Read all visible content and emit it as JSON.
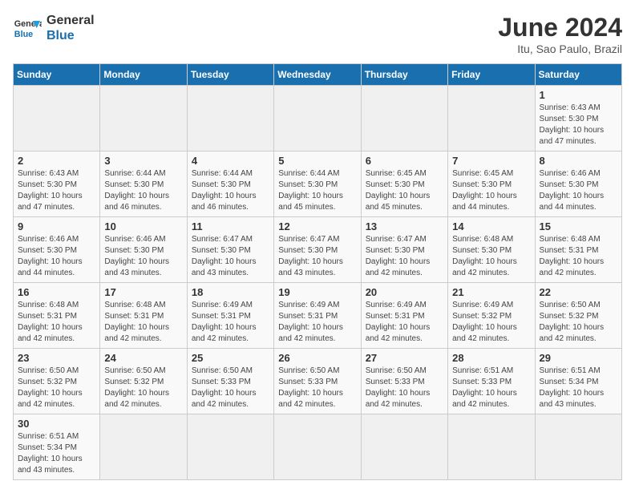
{
  "header": {
    "logo_line1": "General",
    "logo_line2": "Blue",
    "month_title": "June 2024",
    "subtitle": "Itu, Sao Paulo, Brazil"
  },
  "weekdays": [
    "Sunday",
    "Monday",
    "Tuesday",
    "Wednesday",
    "Thursday",
    "Friday",
    "Saturday"
  ],
  "weeks": [
    [
      {
        "day": "",
        "info": ""
      },
      {
        "day": "",
        "info": ""
      },
      {
        "day": "",
        "info": ""
      },
      {
        "day": "",
        "info": ""
      },
      {
        "day": "",
        "info": ""
      },
      {
        "day": "",
        "info": ""
      },
      {
        "day": "1",
        "info": "Sunrise: 6:43 AM\nSunset: 5:30 PM\nDaylight: 10 hours\nand 47 minutes."
      }
    ],
    [
      {
        "day": "2",
        "info": "Sunrise: 6:43 AM\nSunset: 5:30 PM\nDaylight: 10 hours\nand 47 minutes."
      },
      {
        "day": "3",
        "info": "Sunrise: 6:44 AM\nSunset: 5:30 PM\nDaylight: 10 hours\nand 46 minutes."
      },
      {
        "day": "4",
        "info": "Sunrise: 6:44 AM\nSunset: 5:30 PM\nDaylight: 10 hours\nand 46 minutes."
      },
      {
        "day": "5",
        "info": "Sunrise: 6:44 AM\nSunset: 5:30 PM\nDaylight: 10 hours\nand 45 minutes."
      },
      {
        "day": "6",
        "info": "Sunrise: 6:45 AM\nSunset: 5:30 PM\nDaylight: 10 hours\nand 45 minutes."
      },
      {
        "day": "7",
        "info": "Sunrise: 6:45 AM\nSunset: 5:30 PM\nDaylight: 10 hours\nand 44 minutes."
      },
      {
        "day": "8",
        "info": "Sunrise: 6:46 AM\nSunset: 5:30 PM\nDaylight: 10 hours\nand 44 minutes."
      }
    ],
    [
      {
        "day": "9",
        "info": "Sunrise: 6:46 AM\nSunset: 5:30 PM\nDaylight: 10 hours\nand 44 minutes."
      },
      {
        "day": "10",
        "info": "Sunrise: 6:46 AM\nSunset: 5:30 PM\nDaylight: 10 hours\nand 43 minutes."
      },
      {
        "day": "11",
        "info": "Sunrise: 6:47 AM\nSunset: 5:30 PM\nDaylight: 10 hours\nand 43 minutes."
      },
      {
        "day": "12",
        "info": "Sunrise: 6:47 AM\nSunset: 5:30 PM\nDaylight: 10 hours\nand 43 minutes."
      },
      {
        "day": "13",
        "info": "Sunrise: 6:47 AM\nSunset: 5:30 PM\nDaylight: 10 hours\nand 42 minutes."
      },
      {
        "day": "14",
        "info": "Sunrise: 6:48 AM\nSunset: 5:30 PM\nDaylight: 10 hours\nand 42 minutes."
      },
      {
        "day": "15",
        "info": "Sunrise: 6:48 AM\nSunset: 5:31 PM\nDaylight: 10 hours\nand 42 minutes."
      }
    ],
    [
      {
        "day": "16",
        "info": "Sunrise: 6:48 AM\nSunset: 5:31 PM\nDaylight: 10 hours\nand 42 minutes."
      },
      {
        "day": "17",
        "info": "Sunrise: 6:48 AM\nSunset: 5:31 PM\nDaylight: 10 hours\nand 42 minutes."
      },
      {
        "day": "18",
        "info": "Sunrise: 6:49 AM\nSunset: 5:31 PM\nDaylight: 10 hours\nand 42 minutes."
      },
      {
        "day": "19",
        "info": "Sunrise: 6:49 AM\nSunset: 5:31 PM\nDaylight: 10 hours\nand 42 minutes."
      },
      {
        "day": "20",
        "info": "Sunrise: 6:49 AM\nSunset: 5:31 PM\nDaylight: 10 hours\nand 42 minutes."
      },
      {
        "day": "21",
        "info": "Sunrise: 6:49 AM\nSunset: 5:32 PM\nDaylight: 10 hours\nand 42 minutes."
      },
      {
        "day": "22",
        "info": "Sunrise: 6:50 AM\nSunset: 5:32 PM\nDaylight: 10 hours\nand 42 minutes."
      }
    ],
    [
      {
        "day": "23",
        "info": "Sunrise: 6:50 AM\nSunset: 5:32 PM\nDaylight: 10 hours\nand 42 minutes."
      },
      {
        "day": "24",
        "info": "Sunrise: 6:50 AM\nSunset: 5:32 PM\nDaylight: 10 hours\nand 42 minutes."
      },
      {
        "day": "25",
        "info": "Sunrise: 6:50 AM\nSunset: 5:33 PM\nDaylight: 10 hours\nand 42 minutes."
      },
      {
        "day": "26",
        "info": "Sunrise: 6:50 AM\nSunset: 5:33 PM\nDaylight: 10 hours\nand 42 minutes."
      },
      {
        "day": "27",
        "info": "Sunrise: 6:50 AM\nSunset: 5:33 PM\nDaylight: 10 hours\nand 42 minutes."
      },
      {
        "day": "28",
        "info": "Sunrise: 6:51 AM\nSunset: 5:33 PM\nDaylight: 10 hours\nand 42 minutes."
      },
      {
        "day": "29",
        "info": "Sunrise: 6:51 AM\nSunset: 5:34 PM\nDaylight: 10 hours\nand 43 minutes."
      }
    ],
    [
      {
        "day": "30",
        "info": "Sunrise: 6:51 AM\nSunset: 5:34 PM\nDaylight: 10 hours\nand 43 minutes."
      },
      {
        "day": "",
        "info": ""
      },
      {
        "day": "",
        "info": ""
      },
      {
        "day": "",
        "info": ""
      },
      {
        "day": "",
        "info": ""
      },
      {
        "day": "",
        "info": ""
      },
      {
        "day": "",
        "info": ""
      }
    ]
  ]
}
